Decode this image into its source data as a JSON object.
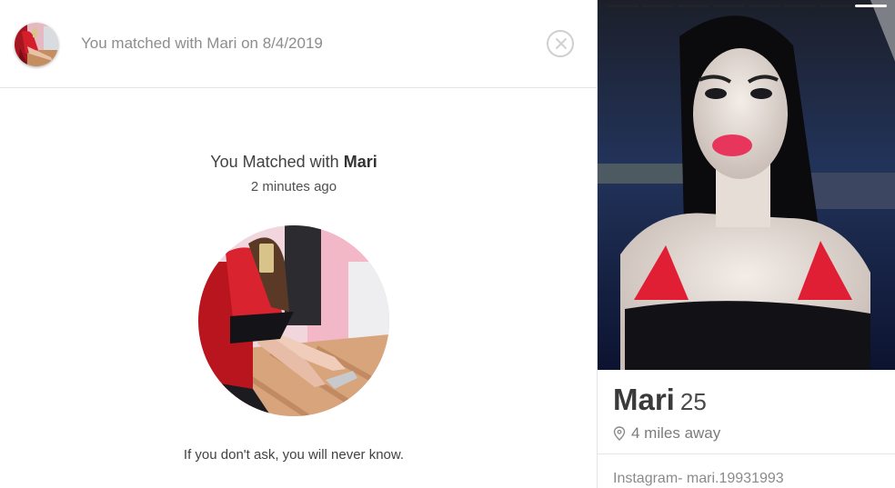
{
  "header": {
    "text": "You matched with Mari on 8/4/2019",
    "close_icon": "close-circle-icon"
  },
  "match": {
    "title_prefix": "You Matched with ",
    "title_name": "Mari",
    "time_ago": "2 minutes ago",
    "message": "If you don't ask, you will never know."
  },
  "profile": {
    "name": "Mari",
    "age": "25",
    "distance": "4 miles away",
    "bio": "Instagram- mari.19931993",
    "photo_count": 8,
    "active_photo_index": 7
  },
  "colors": {
    "text_muted": "#8d8d8d",
    "divider": "#e2e4e8",
    "dress_red": "#d9232f"
  }
}
